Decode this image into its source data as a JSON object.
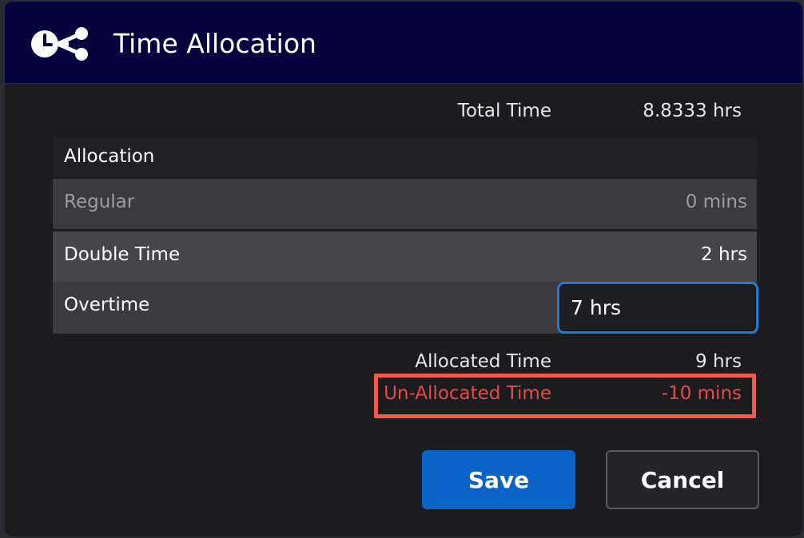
{
  "dialog": {
    "title": "Time Allocation",
    "logo_icon": "clock-share-icon"
  },
  "summary": {
    "total_label": "Total Time",
    "total_value": "8.8333 hrs",
    "allocated_label": "Allocated Time",
    "allocated_value": "9 hrs",
    "unallocated_label": "Un-Allocated Time",
    "unallocated_value": "-10 mins"
  },
  "table": {
    "header": "Allocation",
    "rows": [
      {
        "label": "Regular",
        "value": "0 mins"
      },
      {
        "label": "Double Time",
        "value": "2 hrs"
      },
      {
        "label": "Overtime",
        "value": "7 hrs"
      }
    ]
  },
  "buttons": {
    "save": "Save",
    "cancel": "Cancel"
  },
  "colors": {
    "header_bg": "#05043f",
    "accent_blue": "#0a63c7",
    "error_red": "#e84a47",
    "highlight_box": "#f05a4e"
  }
}
